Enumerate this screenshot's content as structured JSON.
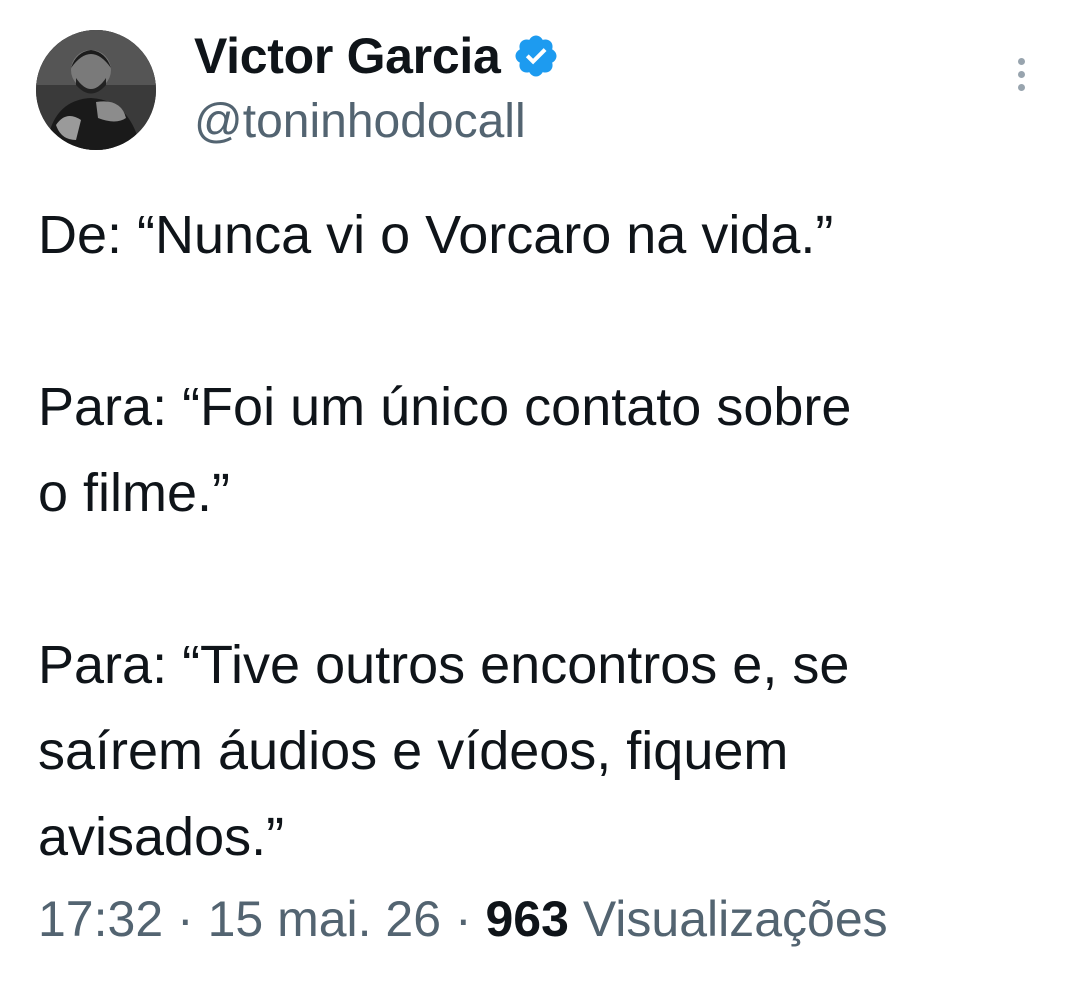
{
  "author": {
    "display_name": "Victor Garcia",
    "handle": "@toninhodocall",
    "verified": true,
    "verified_color": "#1d9bf0"
  },
  "tweet": {
    "paragraphs": [
      [
        "De: “Nunca vi o Vorcaro na vida.”"
      ],
      [
        "Para: “Foi um único contato sobre",
        "o filme.”"
      ],
      [
        "Para: “Tive outros encontros e, se",
        "saírem áudios e vídeos, fiquem",
        "avisados.”"
      ]
    ]
  },
  "meta": {
    "time": "17:32",
    "separator": " · ",
    "date": "15 mai. 26",
    "views_count": "963",
    "views_label": "Visualizações"
  },
  "icons": {
    "more": "more-vertical-icon",
    "verified": "verified-badge-icon"
  }
}
